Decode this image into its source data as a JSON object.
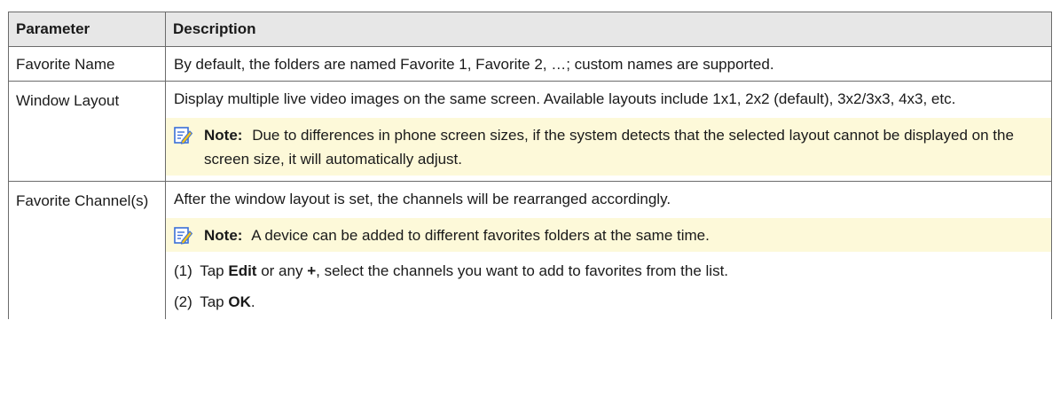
{
  "table": {
    "headers": {
      "parameter": "Parameter",
      "description": "Description"
    },
    "rows": [
      {
        "parameter": "Favorite Name",
        "description": "By default, the folders are named Favorite 1, Favorite 2, …; custom names are supported."
      },
      {
        "parameter": "Window Layout",
        "description": "Display multiple live video images on the same screen. Available layouts include 1x1, 2x2 (default), 3x2/3x3, 4x3, etc.",
        "note": "Due to differences in phone screen sizes, if the system detects that the selected layout cannot be displayed on the screen size, it will automatically adjust."
      },
      {
        "parameter": "Favorite Channel(s)",
        "description": "After the window layout is set, the channels will be rearranged accordingly.",
        "note": "A device can be added to different favorites folders at the same time.",
        "steps": [
          {
            "num": "(1)",
            "prefix": "Tap",
            "bold1": "Edit",
            "mid": "or any",
            "bold2": "+",
            "suffix": ", select the channels you want to add to favorites from the list."
          },
          {
            "num": "(2)",
            "prefix": "Tap",
            "bold1": "OK",
            "suffix": "."
          }
        ]
      }
    ]
  },
  "note_label": "Note:",
  "note_icon": "note-pencil-icon",
  "colors": {
    "header_bg": "#e7e7e7",
    "note_bg": "#fdf9d9",
    "note_icon": "#3a6fd8",
    "border": "#6b6b6b"
  }
}
